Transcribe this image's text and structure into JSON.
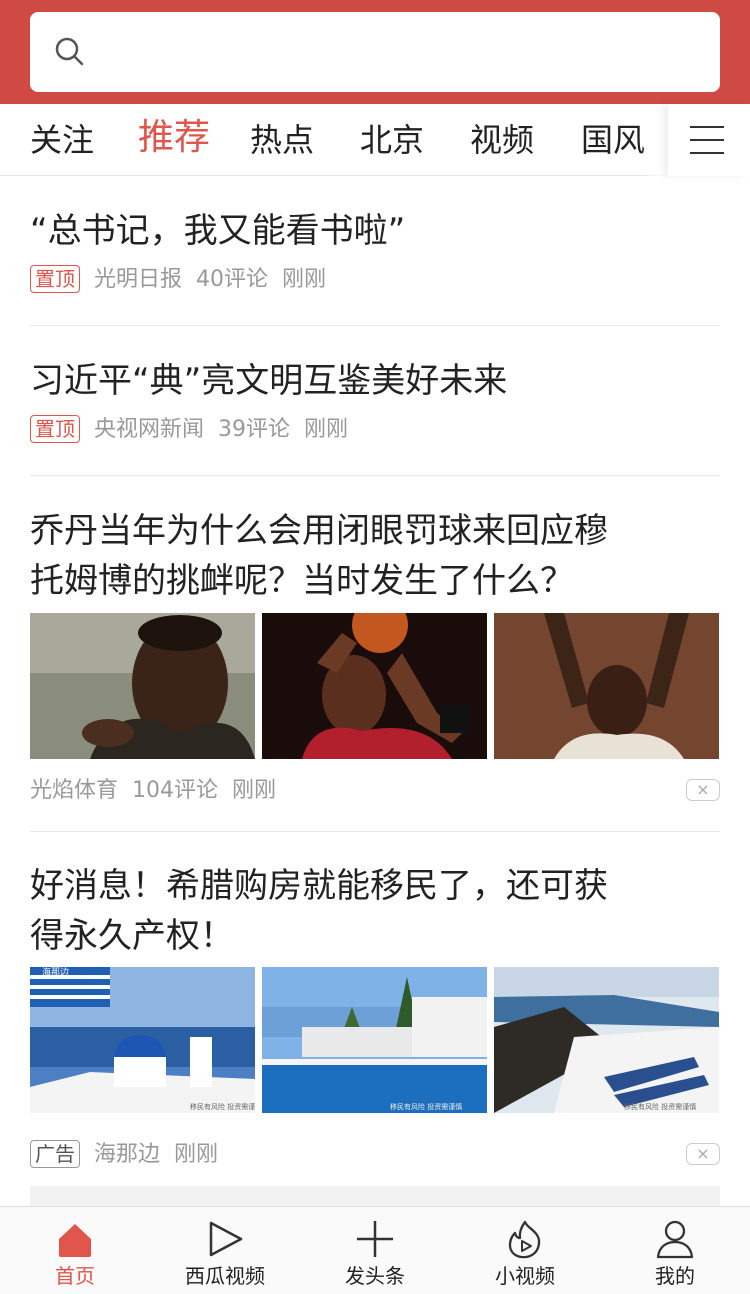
{
  "search": {
    "placeholder": ""
  },
  "channels": [
    "关注",
    "推荐",
    "热点",
    "北京",
    "视频",
    "国风"
  ],
  "active_channel": "推荐",
  "feed": [
    {
      "title": "“总书记，我又能看书啦”",
      "tag": "置顶",
      "source": "光明日报",
      "comments": "40评论",
      "time": "刚刚"
    },
    {
      "title": "习近平“典”亮文明互鉴美好未来",
      "tag": "置顶",
      "source": "央视网新闻",
      "comments": "39评论",
      "time": "刚刚"
    },
    {
      "title_line1": "乔丹当年为什么会用闭眼罚球来回应穆",
      "title_line2": "托姆博的挑衅呢？当时发生了什么？",
      "source": "光焰体育",
      "comments": "104评论",
      "time": "刚刚",
      "close": "×"
    },
    {
      "title_line1": "好消息！希腊购房就能移民了，还可获",
      "title_line2": "得永久产权！",
      "tag": "广告",
      "source": "海那边",
      "time": "刚刚",
      "close": "×",
      "watermark": "移民有风险 投资需谨慎",
      "img_label": "海那边"
    }
  ],
  "tabbar": [
    {
      "label": "首页",
      "icon": "home-icon"
    },
    {
      "label": "西瓜视频",
      "icon": "play-icon"
    },
    {
      "label": "发头条",
      "icon": "plus-icon"
    },
    {
      "label": "小视频",
      "icon": "flame-play-icon"
    },
    {
      "label": "我的",
      "icon": "user-icon"
    }
  ],
  "colors": {
    "brand_red": "#cf4a43",
    "active_red": "#e0554c"
  }
}
